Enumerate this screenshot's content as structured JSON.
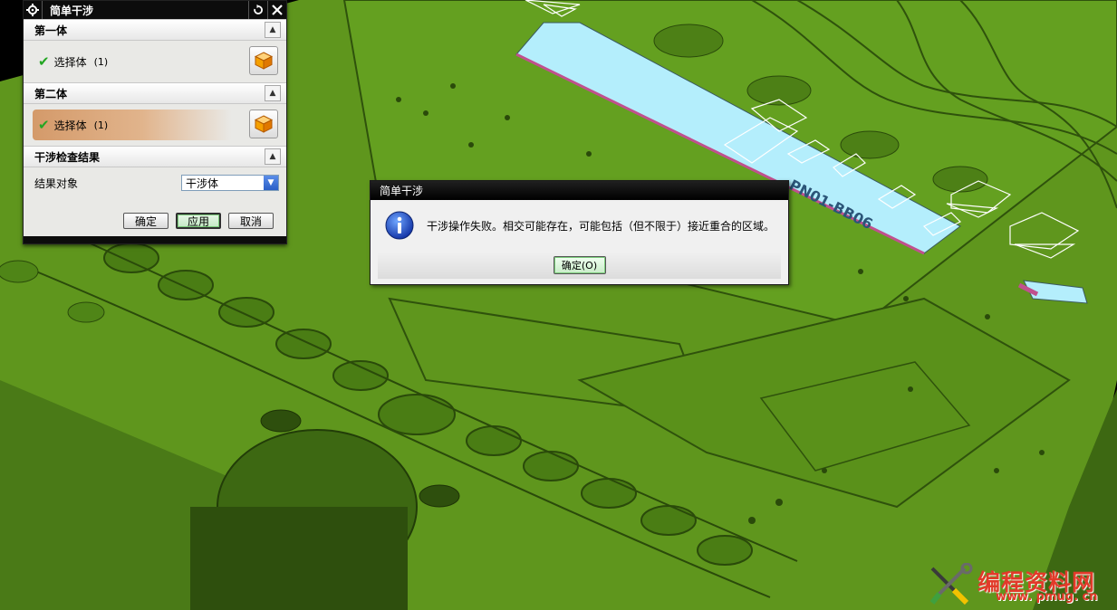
{
  "panel": {
    "title": "简单干涉",
    "sections": [
      {
        "title": "第一体",
        "row_label": "选择体",
        "row_count": "(1)"
      },
      {
        "title": "第二体",
        "row_label": "选择体",
        "row_count": "(1)"
      },
      {
        "title": "干涉检查结果"
      }
    ],
    "result_label": "结果对象",
    "result_value": "干涉体",
    "buttons": {
      "ok": "确定",
      "apply": "应用",
      "cancel": "取消"
    }
  },
  "dialog": {
    "title": "简单干涉",
    "message": "干涉操作失败。相交可能存在，可能包括（但不限于）接近重合的区域。",
    "ok_label": "确定(O)"
  },
  "viewport": {
    "model_label": "PN01-BB06",
    "colors": {
      "mold_green": "#5f961d",
      "mold_dark": "#3a6210",
      "insert_cyan": "#b4eefc",
      "edge_magenta": "#c0508e"
    }
  },
  "watermark": {
    "text": "编程资料网",
    "url": "www. pmug. cn"
  },
  "icons": [
    "gear-icon",
    "reset-icon",
    "close-icon",
    "chevron-up-icon",
    "check-icon",
    "solid-body-icon",
    "dropdown-arrow-icon",
    "info-icon"
  ]
}
